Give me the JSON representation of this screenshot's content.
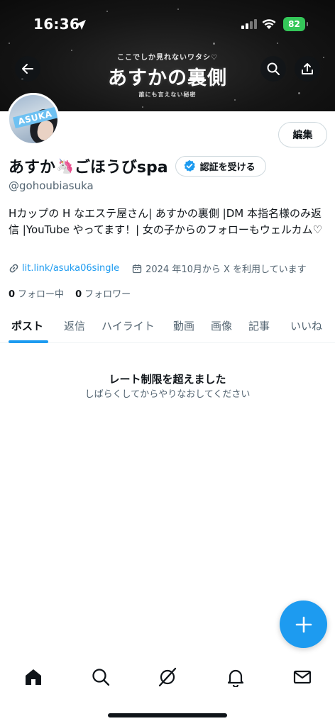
{
  "status_bar": {
    "time": "16:36",
    "battery": "82"
  },
  "banner": {
    "subtitle": "ここでしか見れないワタシ♡",
    "title": "あすかの裏側",
    "tagline": "誰にも言えない秘密"
  },
  "avatar": {
    "tag": "ASUKA"
  },
  "profile": {
    "name_part1": "あすか",
    "name_emoji": "🦄",
    "name_part2": "ごほうびspa",
    "verify_label": "認証を受ける",
    "edit_label": "編集",
    "handle": "@gohoubiasuka",
    "bio": "Hカップの H なエステ屋さん| あすかの裏側 |DM 本指名様のみ返信 |YouTube やってます！| 女の子からのフォローもウェルカム♡",
    "link": "lit.link/asuka06single",
    "joined": "2024 年10月から X を利用しています",
    "following_count": "0",
    "following_label": "フォロー中",
    "followers_count": "0",
    "followers_label": "フォロワー"
  },
  "tabs": [
    {
      "label": "ポスト",
      "active": true
    },
    {
      "label": "返信"
    },
    {
      "label": "ハイライト"
    },
    {
      "label": "動画"
    },
    {
      "label": "画像"
    },
    {
      "label": "記事"
    },
    {
      "label": "いいね"
    }
  ],
  "empty_state": {
    "title": "レート制限を超えました",
    "subtitle": "しばらくしてからやりなおしてください"
  },
  "colors": {
    "accent": "#1d9bf0",
    "text": "#0f1419",
    "secondary": "#536471"
  },
  "icons": {
    "back": "arrow-left-icon",
    "search": "search-icon",
    "share": "share-icon",
    "verified": "verified-badge-icon",
    "link": "link-icon",
    "calendar": "calendar-icon",
    "compose": "plus-icon",
    "nav": [
      "home-icon",
      "search-icon",
      "grok-icon",
      "bell-icon",
      "mail-icon"
    ]
  }
}
